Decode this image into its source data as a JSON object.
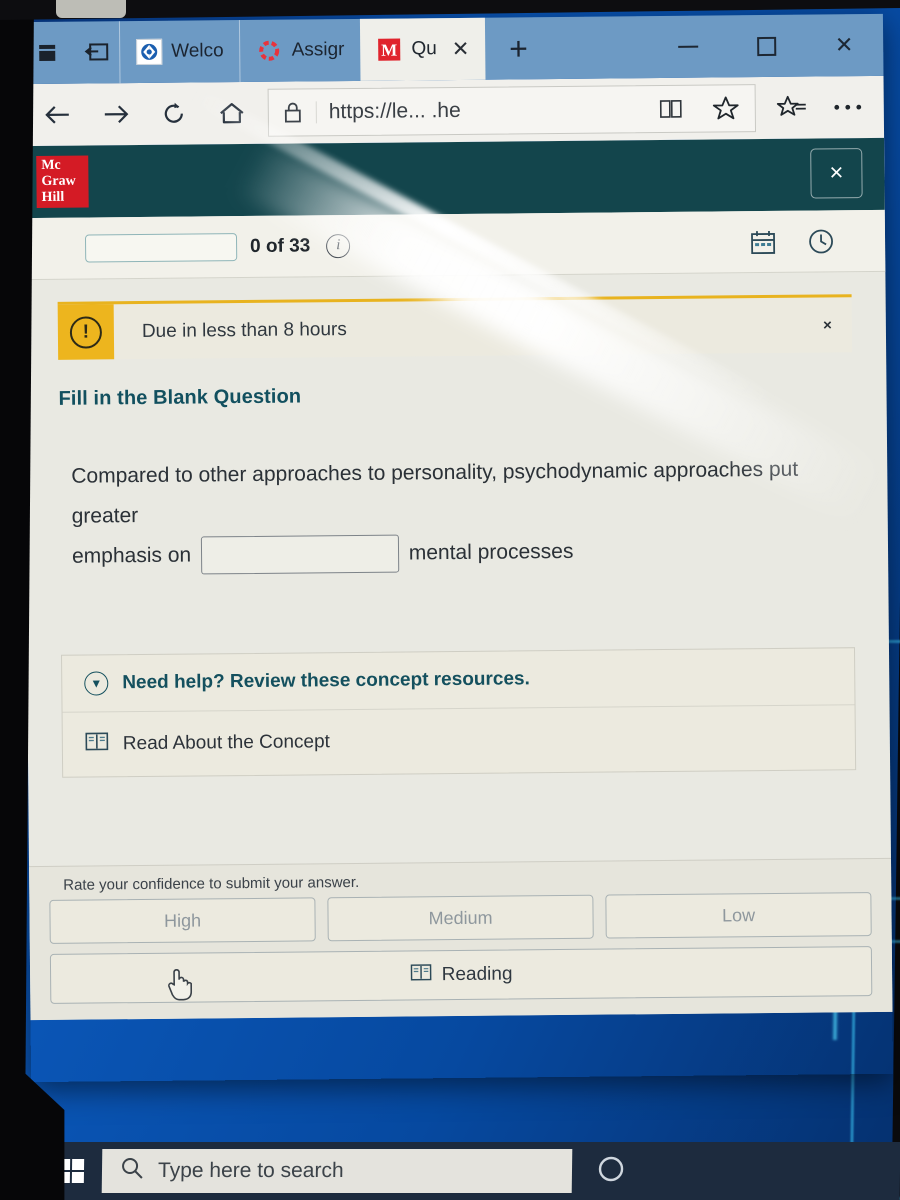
{
  "browser": {
    "tabs": [
      {
        "label": "Welco",
        "icon": "edge-tab-favicon",
        "active": false
      },
      {
        "label": "Assigr",
        "icon": "connect-spinner-favicon",
        "active": false
      },
      {
        "label": "Qu",
        "icon": "mcgrawhill-m-favicon",
        "active": true
      }
    ],
    "new_tab_label": "+",
    "toolbar": {
      "back_icon": "back-arrow-icon",
      "forward_icon": "forward-arrow-icon",
      "refresh_icon": "refresh-icon",
      "home_icon": "home-icon",
      "lock_icon": "lock-icon",
      "url": "https://le...                  .he",
      "reading_view_icon": "reading-view-icon",
      "favorite_icon": "star-icon",
      "reading_list_icon": "star-list-icon",
      "more_icon": "ellipsis-icon"
    },
    "window_controls": {
      "minimize": "minimize-icon",
      "maximize": "maximize-icon",
      "close": "close-icon"
    }
  },
  "app": {
    "brand": {
      "line1": "Mc",
      "line2": "Graw",
      "line3": "Hill",
      "color": "#d41b25"
    },
    "header_close_label": "×",
    "header_bg": "#13454c",
    "progress": {
      "count_label": "0 of 33",
      "info_icon": "info-icon",
      "completed": 0,
      "total": 33
    },
    "header_tools": [
      {
        "name": "calendar-icon"
      },
      {
        "name": "clock-icon"
      }
    ],
    "alert": {
      "icon": "exclamation-icon",
      "text": "Due in less than 8 hours",
      "close_label": "×",
      "accent_color": "#e8b31f"
    },
    "question": {
      "type_label": "Fill in the Blank Question",
      "text_before": "Compared to other approaches to personality, psychodynamic approaches put greater",
      "text_prefix": "emphasis on",
      "input_value": "",
      "input_placeholder": "",
      "text_suffix": "mental processes"
    },
    "help": {
      "chevron_icon": "chevron-down-icon",
      "title": "Need help? Review these concept resources.",
      "item_icon": "book-icon",
      "item_label": "Read About the Concept"
    },
    "footer": {
      "rate_label": "Rate your confidence to submit your answer.",
      "confidence_buttons": [
        "High",
        "Medium",
        "Low"
      ],
      "reading_icon": "book-icon",
      "reading_label": "Reading"
    }
  },
  "os": {
    "taskbar": {
      "start_icon": "windows-start-icon",
      "search_icon": "search-icon",
      "search_placeholder": "Type here to search",
      "cortana_icon": "cortana-circle-icon"
    }
  }
}
